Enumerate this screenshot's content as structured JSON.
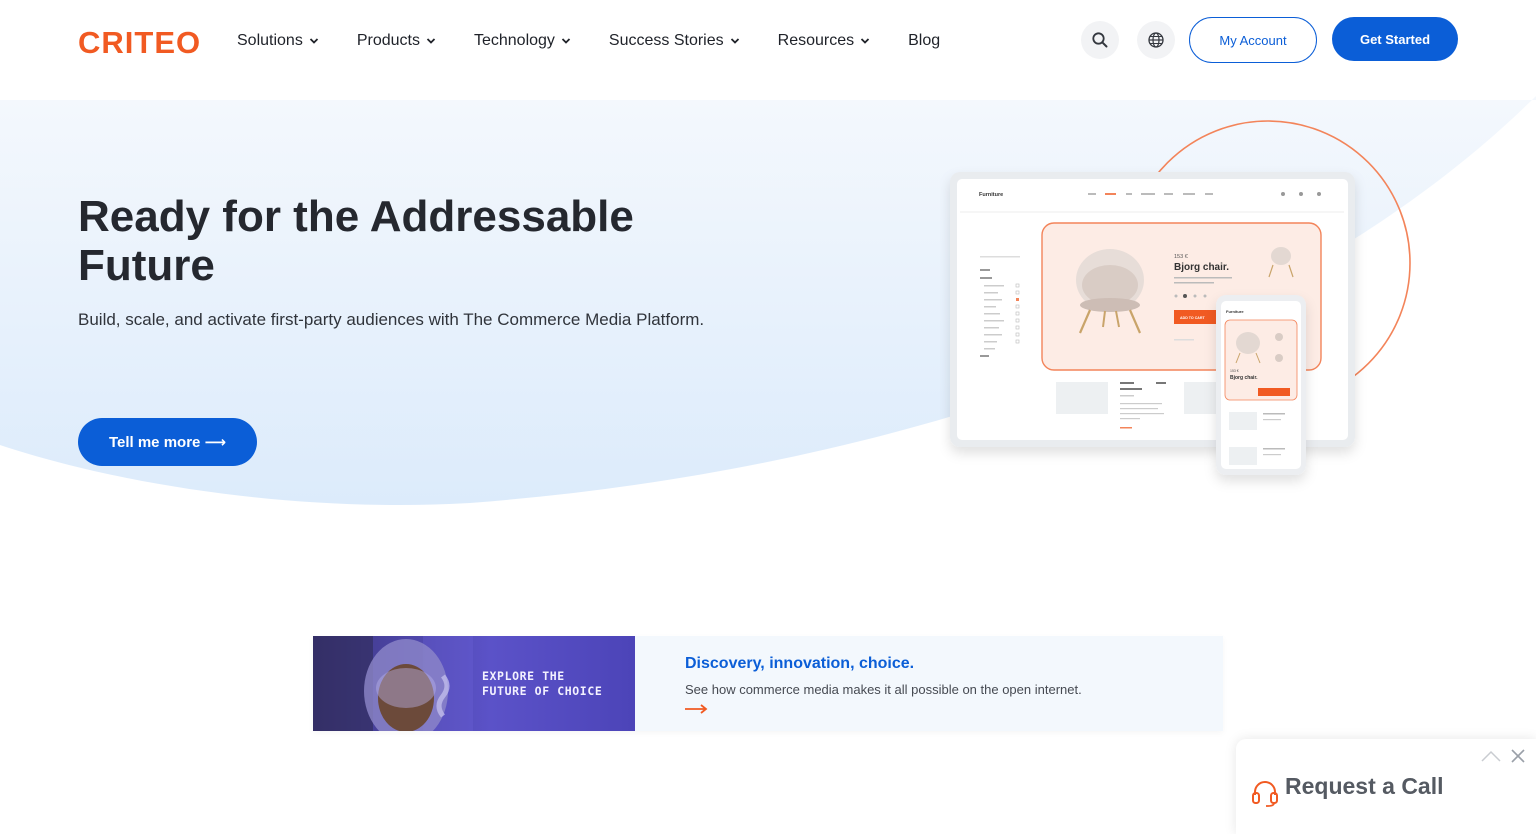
{
  "brand": {
    "logo_text": "CRITEO",
    "accent": "#f15a22",
    "primary": "#0b5ed7"
  },
  "nav": {
    "items": [
      {
        "label": "Solutions",
        "has_dropdown": true
      },
      {
        "label": "Products",
        "has_dropdown": true
      },
      {
        "label": "Technology",
        "has_dropdown": true
      },
      {
        "label": "Success Stories",
        "has_dropdown": true
      },
      {
        "label": "Resources",
        "has_dropdown": true
      },
      {
        "label": "Blog",
        "has_dropdown": false
      }
    ],
    "search_icon": "search-icon",
    "language_icon": "globe-icon",
    "my_account": "My Account",
    "get_started": "Get Started"
  },
  "hero": {
    "title": "Ready for the Addressable Future",
    "subtitle": "Build, scale, and activate first-party audiences with The Commerce Media Platform.",
    "cta": "Tell me more ⟶"
  },
  "mockup": {
    "site_name": "Furniture",
    "price": "153 €",
    "product": "Bjorg chair.",
    "cta": "ADD TO CART",
    "mobile_price": "153 €",
    "mobile_product": "Bjorg chair."
  },
  "banner": {
    "image_text_line1": "EXPLORE THE",
    "image_text_line2": "FUTURE OF CHOICE",
    "title": "Discovery, innovation, choice.",
    "description": "See how commerce media makes it all possible on the open internet."
  },
  "call_widget": {
    "label": "Request a Call",
    "icon": "headset-icon",
    "minimize_icon": "chevron-up-icon",
    "close_icon": "close-icon"
  }
}
